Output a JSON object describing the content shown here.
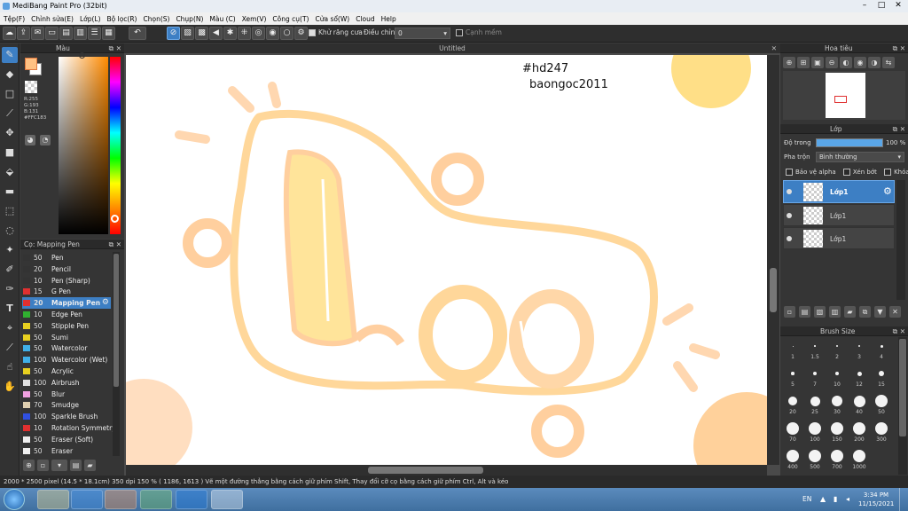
{
  "window": {
    "title": "MediBang Paint Pro (32bit)"
  },
  "menu": [
    "Tệp(F)",
    "Chỉnh sửa(E)",
    "Lớp(L)",
    "Bộ lọc(R)",
    "Chọn(S)",
    "Chụp(N)",
    "Màu (C)",
    "Xem(V)",
    "Công cụ(T)",
    "Cửa sổ(W)",
    "Cloud",
    "Help"
  ],
  "toolbar": {
    "antialias_label": "Khử răng cưa",
    "adjust_label": "Điều chỉnh",
    "adjust_value": "0",
    "edge_label": "Cạnh mềm"
  },
  "color_panel": {
    "title": "Màu",
    "r": "R:255",
    "g": "G:193",
    "b": "B:131",
    "hex": "#FFC183",
    "fg_color": "#FFC183"
  },
  "brush_panel": {
    "title": "Cọ: Mapping Pen",
    "items": [
      {
        "size": "50",
        "name": "Pen",
        "color": "#333333"
      },
      {
        "size": "20",
        "name": "Pencil",
        "color": "#333333"
      },
      {
        "size": "10",
        "name": "Pen (Sharp)",
        "color": "#333333"
      },
      {
        "size": "15",
        "name": "G Pen",
        "color": "#e03030"
      },
      {
        "size": "20",
        "name": "Mapping Pen",
        "color": "#e03030"
      },
      {
        "size": "10",
        "name": "Edge Pen",
        "color": "#30b030"
      },
      {
        "size": "50",
        "name": "Stipple Pen",
        "color": "#e8d020"
      },
      {
        "size": "50",
        "name": "Sumi",
        "color": "#e8d020"
      },
      {
        "size": "50",
        "name": "Watercolor",
        "color": "#40b0e8"
      },
      {
        "size": "100",
        "name": "Watercolor (Wet)",
        "color": "#40b0e8"
      },
      {
        "size": "50",
        "name": "Acrylic",
        "color": "#e8d020"
      },
      {
        "size": "100",
        "name": "Airbrush",
        "color": "#e0e0e0"
      },
      {
        "size": "50",
        "name": "Blur",
        "color": "#f0a0e0"
      },
      {
        "size": "70",
        "name": "Smudge",
        "color": "#e0d0b0"
      },
      {
        "size": "100",
        "name": "Sparkle Brush",
        "color": "#3050e0"
      },
      {
        "size": "10",
        "name": "Rotation Symmetry",
        "color": "#e03030"
      },
      {
        "size": "50",
        "name": "Eraser (Soft)",
        "color": "#f0f0f0"
      },
      {
        "size": "50",
        "name": "Eraser",
        "color": "#f0f0f0"
      }
    ]
  },
  "canvas": {
    "title": "Untitled",
    "text1": "#hd247",
    "text2": "baongoc2011"
  },
  "navigator": {
    "title": "Hoa tiêu"
  },
  "layer_panel": {
    "title": "Lớp",
    "opacity_label": "Độ trong",
    "opacity_value": "100 %",
    "blend_label": "Pha trộn",
    "blend_value": "Bình thường",
    "protect_alpha": "Bảo vệ alpha",
    "clipping": "Xén bớt",
    "lock": "Khóa",
    "layers": [
      "Lớp1",
      "Lớp1",
      "Lớp1"
    ]
  },
  "brush_size": {
    "title": "Brush Size",
    "labels": [
      "1",
      "1.5",
      "2",
      "3",
      "4",
      "5",
      "7",
      "10",
      "12",
      "15",
      "20",
      "25",
      "30",
      "40",
      "50",
      "70",
      "100",
      "150",
      "200",
      "300",
      "400",
      "500",
      "700",
      "1000"
    ]
  },
  "status": {
    "text": "2000 * 2500 pixel   (14.5 * 18.1cm)   350 dpi   150 %   ( 1186, 1613 )   Vẽ một đường thẳng bằng cách giữ phím Shift, Thay đổi cỡ cọ bằng cách giữ phím Ctrl, Alt và kéo"
  },
  "taskbar": {
    "lang": "EN",
    "time": "3:34 PM",
    "date": "11/15/2021"
  }
}
